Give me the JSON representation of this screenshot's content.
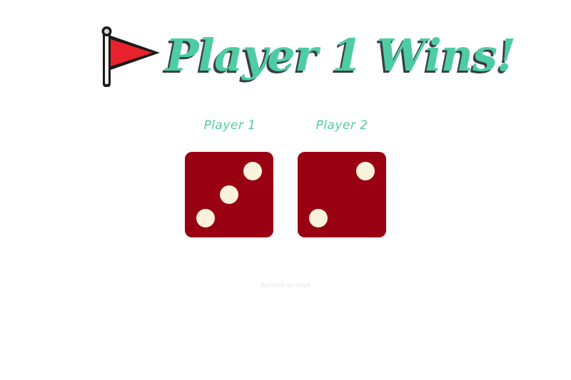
{
  "title": "Player 1 Wins!",
  "icons": {
    "flag": "flag-icon"
  },
  "players": [
    {
      "label": "Player 1",
      "die_value": 3
    },
    {
      "label": "Player 2",
      "die_value": 2
    }
  ],
  "footer": {
    "text": "Refresh to start"
  },
  "colors": {
    "accent": "#4ecca3",
    "title_shadow": "#393e46",
    "die_face": "#990011",
    "die_pip": "#fbf2dc",
    "flag_red": "#e8222c",
    "footer_text": "#e4e4e4"
  }
}
